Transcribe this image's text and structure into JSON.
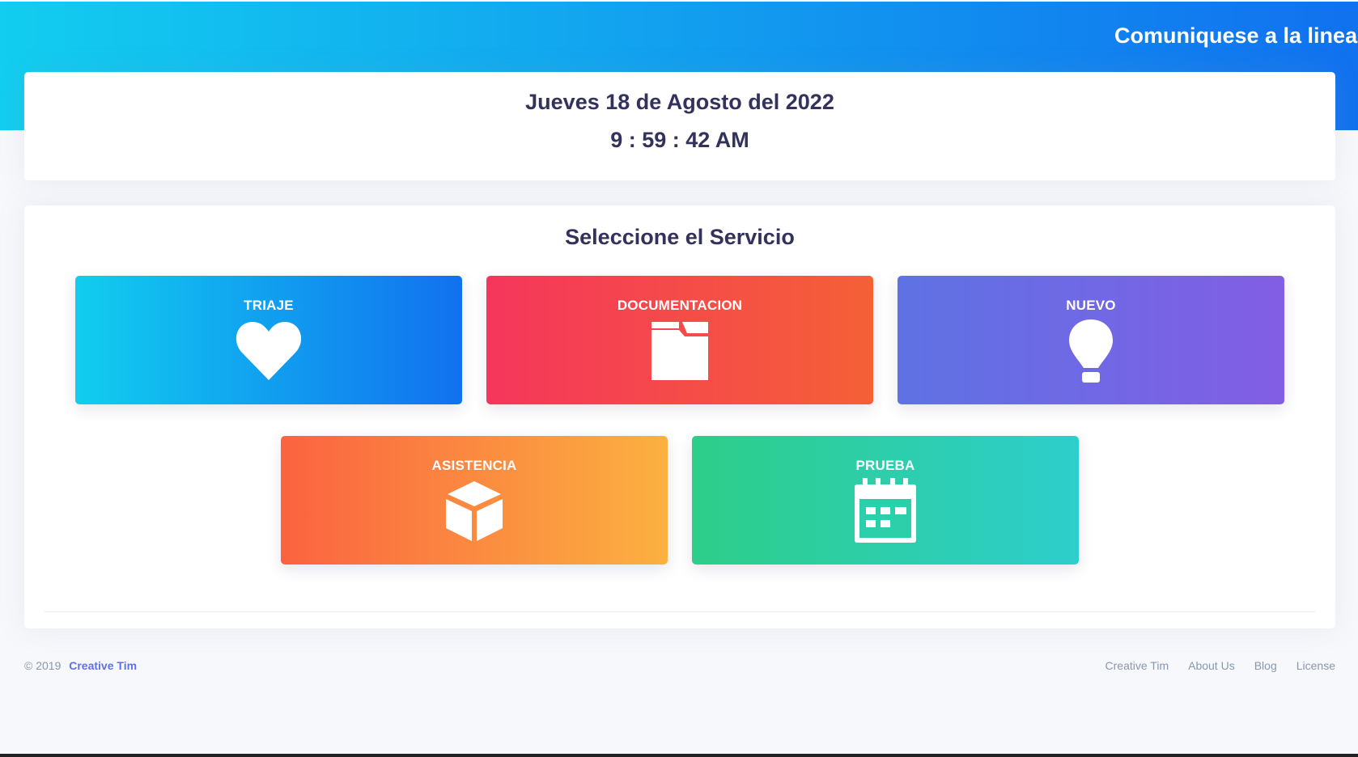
{
  "header": {
    "marquee_text": "Comuniquese a la linea"
  },
  "datetime": {
    "date": "Jueves 18 de Agosto del 2022",
    "time": "9 : 59 : 42 AM"
  },
  "services": {
    "title": "Seleccione el Servicio",
    "items": [
      {
        "label": "TRIAJE",
        "icon": "heart-icon",
        "gradient": [
          "#11cdef",
          "#1171ef"
        ]
      },
      {
        "label": "DOCUMENTACION",
        "icon": "folder-icon",
        "gradient": [
          "#f5365c",
          "#f56036"
        ]
      },
      {
        "label": "NUEVO",
        "icon": "lightbulb-icon",
        "gradient": [
          "#5e72e4",
          "#825ee4"
        ]
      },
      {
        "label": "ASISTENCIA",
        "icon": "cube-icon",
        "gradient": [
          "#fb6340",
          "#fbb140"
        ]
      },
      {
        "label": "PRUEBA",
        "icon": "calendar-icon",
        "gradient": [
          "#2dce89",
          "#2dcecc"
        ]
      }
    ]
  },
  "footer": {
    "copyright": "© 2019",
    "brand": "Creative Tim",
    "links": [
      "Creative Tim",
      "About Us",
      "Blog",
      "License"
    ]
  }
}
